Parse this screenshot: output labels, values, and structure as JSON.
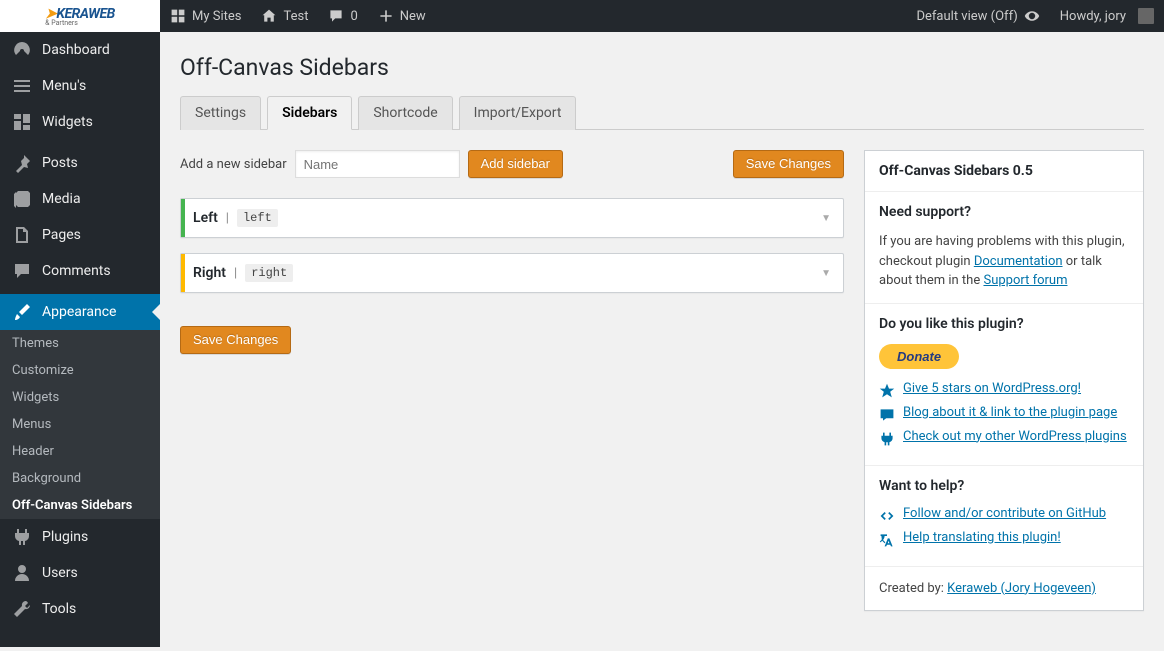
{
  "topbar": {
    "logo_main": "KERAWEB",
    "logo_sub": "& Partners",
    "my_sites": "My Sites",
    "site_name": "Test",
    "comment_count": "0",
    "new": "New",
    "default_view": "Default view (Off)",
    "howdy": "Howdy, jory"
  },
  "sidebar": {
    "dashboard": "Dashboard",
    "menus": "Menu's",
    "widgets": "Widgets",
    "posts": "Posts",
    "media": "Media",
    "pages": "Pages",
    "comments": "Comments",
    "appearance": "Appearance",
    "submenu": {
      "themes": "Themes",
      "customize": "Customize",
      "widgets": "Widgets",
      "menus": "Menus",
      "header": "Header",
      "background": "Background",
      "ocs": "Off-Canvas Sidebars"
    },
    "plugins": "Plugins",
    "users": "Users",
    "tools": "Tools"
  },
  "page": {
    "title": "Off-Canvas Sidebars"
  },
  "tabs": {
    "settings": "Settings",
    "sidebars": "Sidebars",
    "shortcode": "Shortcode",
    "import_export": "Import/Export"
  },
  "form": {
    "add_label": "Add a new sidebar",
    "name_placeholder": "Name",
    "add_button": "Add sidebar",
    "save_button": "Save Changes"
  },
  "sidebars_list": [
    {
      "title": "Left",
      "slug": "left",
      "color": "#46b450"
    },
    {
      "title": "Right",
      "slug": "right",
      "color": "#ffb900"
    }
  ],
  "panel": {
    "version_title": "Off-Canvas Sidebars 0.5",
    "support_heading": "Need support?",
    "support_text_1": "If you are having problems with this plugin, checkout plugin ",
    "support_link_1": "Documentation",
    "support_text_2": " or talk about them in the ",
    "support_link_2": "Support forum",
    "like_heading": "Do you like this plugin?",
    "donate": "Donate",
    "like_links": {
      "stars": "Give 5 stars on WordPress.org!",
      "blog": "Blog about it & link to the plugin page",
      "other": "Check out my other WordPress plugins"
    },
    "help_heading": "Want to help?",
    "help_links": {
      "github": "Follow and/or contribute on GitHub",
      "translate": "Help translating this plugin!"
    },
    "created_by": "Created by: ",
    "created_by_link": "Keraweb (Jory Hogeveen)"
  }
}
